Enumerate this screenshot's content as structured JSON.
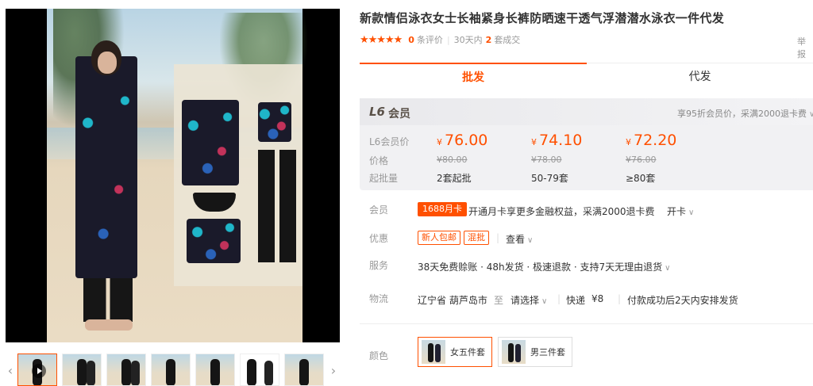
{
  "product": {
    "title": "新款情侣泳衣女士长袖紧身长裤防晒速干透气浮潜潜水泳衣一件代发",
    "stars": "★★★★★",
    "review_count": "0",
    "review_label": "条评价",
    "period_label": "30天内",
    "deal_count": "2",
    "deal_label": "套成交",
    "report": "举报"
  },
  "tabs": [
    {
      "label": "批发",
      "active": true
    },
    {
      "label": "代发",
      "active": false
    }
  ],
  "membership": {
    "badge": "L6",
    "member": "会员",
    "note": "享95折会员价，采满2000退卡费",
    "price_label": "L6会员价",
    "orig_label": "价格",
    "moq_label": "起批量",
    "currency": "¥",
    "tiers": [
      {
        "price": "76.00",
        "orig": "¥80.00",
        "moq": "2套起批"
      },
      {
        "price": "74.10",
        "orig": "¥78.00",
        "moq": "50-79套"
      },
      {
        "price": "72.20",
        "orig": "¥76.00",
        "moq": "≥80套"
      }
    ]
  },
  "info": {
    "member_label": "会员",
    "card_badge": "1688月卡",
    "card_text": "开通月卡享更多金融权益，采满2000退卡费",
    "open_card": "开卡",
    "promo_label": "优惠",
    "promo_tags": [
      "新人包邮",
      "混批"
    ],
    "promo_view": "查看",
    "service_label": "服务",
    "service_text": "38天免费赊账 · 48h发货 · 极速退款 · 支持7天无理由退货",
    "logistics_label": "物流",
    "origin": "辽宁省 葫芦岛市",
    "to": "至",
    "destination": "请选择",
    "express": "快递",
    "express_fee": "¥8",
    "ship_note": "付款成功后2天内安排发货"
  },
  "colors": {
    "label": "颜色",
    "options": [
      {
        "name": "女五件套",
        "selected": true
      },
      {
        "name": "男三件套",
        "selected": false
      }
    ]
  },
  "gallery": {
    "prev": "‹",
    "next": "›"
  },
  "theme": {
    "accent": "#ff5000",
    "price_box_bg": "#f1f1f3"
  }
}
